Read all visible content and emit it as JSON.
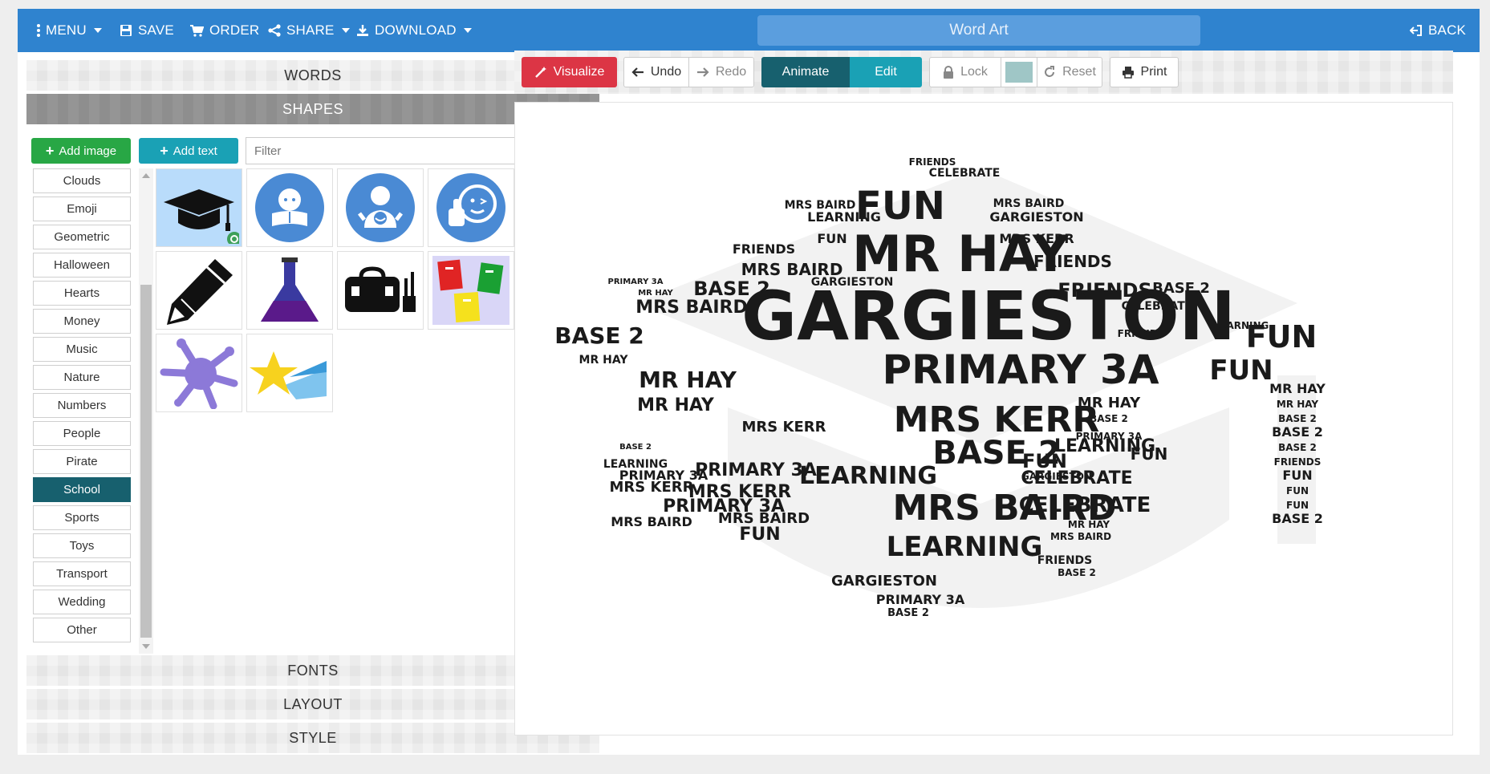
{
  "topbar": {
    "menu_label": "MENU",
    "save_label": "SAVE",
    "order_label": "ORDER",
    "share_label": "SHARE",
    "download_label": "DOWNLOAD",
    "title": "Word Art",
    "back_label": "BACK"
  },
  "sidebar": {
    "sections": {
      "words": "WORDS",
      "shapes": "SHAPES",
      "fonts": "FONTS",
      "layout": "LAYOUT",
      "style": "STYLE"
    },
    "add_image_label": "Add image",
    "add_text_label": "Add text",
    "filter_placeholder": "Filter",
    "categories": [
      "Clouds",
      "Emoji",
      "Geometric",
      "Halloween",
      "Hearts",
      "Money",
      "Music",
      "Nature",
      "Numbers",
      "People",
      "Pirate",
      "School",
      "Sports",
      "Toys",
      "Transport",
      "Wedding",
      "Other"
    ],
    "active_category": "School",
    "shapes": [
      "graduation-cap",
      "child-reading",
      "child-waving",
      "child-thumbs-up",
      "pencil",
      "flask",
      "school-bag",
      "notebooks",
      "paint-splat",
      "shooting-star"
    ],
    "selected_shape": "graduation-cap"
  },
  "toolbar": {
    "visualize_label": "Visualize",
    "undo_label": "Undo",
    "redo_label": "Redo",
    "animate_label": "Animate",
    "edit_label": "Edit",
    "lock_label": "Lock",
    "reset_label": "Reset",
    "print_label": "Print",
    "swatch_color": "#9fc6c6"
  },
  "wordart": {
    "words": [
      "GARGIESTON",
      "MR HAY",
      "PRIMARY 3A",
      "MRS KERR",
      "MRS BAIRD",
      "BASE 2",
      "FUN",
      "FRIENDS",
      "LEARNING",
      "CELEBRATE"
    ]
  },
  "colors": {
    "topbar": "#2f83cf",
    "visualize": "#dc3545",
    "animate": "#17606e",
    "edit": "#1aa1b5",
    "add_image": "#28a745",
    "add_text": "#1aa1b5",
    "selected_tile": "#b9dcfb",
    "icon_blue": "#4a8ad4"
  }
}
